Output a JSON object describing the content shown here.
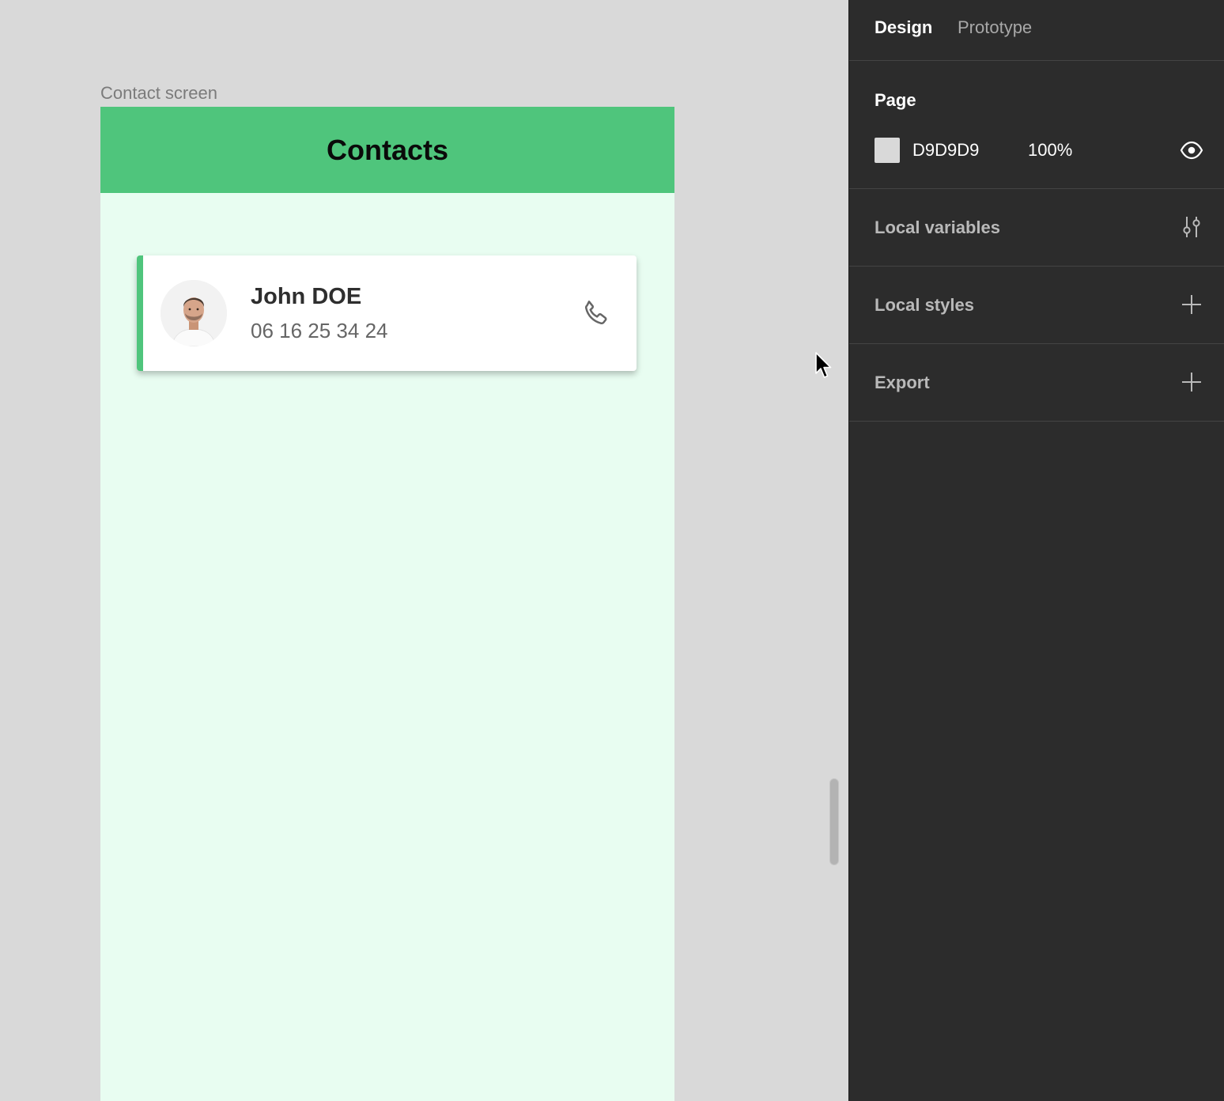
{
  "canvas": {
    "frame_label": "Contact screen",
    "frame": {
      "title": "Contacts",
      "contact": {
        "name": "John DOE",
        "phone": "06 16 25 34 24",
        "avatar_icon": "person-photo",
        "action_icon": "phone-icon"
      }
    }
  },
  "panel": {
    "tabs": [
      {
        "label": "Design",
        "active": true
      },
      {
        "label": "Prototype",
        "active": false
      }
    ],
    "page": {
      "title": "Page",
      "color_hex": "D9D9D9",
      "opacity": "100%",
      "visibility_icon": "eye-icon"
    },
    "sections": [
      {
        "label": "Local variables",
        "icon": "sliders-icon"
      },
      {
        "label": "Local styles",
        "icon": "plus-icon"
      },
      {
        "label": "Export",
        "icon": "plus-icon"
      }
    ]
  },
  "colors": {
    "canvas_bg": "#D9D9D9",
    "header_green": "#4FC57C",
    "frame_bg": "#E8FDF1",
    "panel_bg": "#2C2C2C"
  }
}
